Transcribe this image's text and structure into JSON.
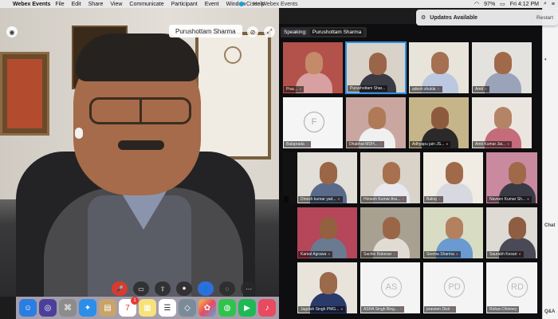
{
  "menubar": {
    "app_name": "Webex Events",
    "items": [
      "File",
      "Edit",
      "Share",
      "View",
      "Communicate",
      "Participant",
      "Event",
      "Window",
      "Help"
    ],
    "window_title": "Cisco Webex Events",
    "battery": "97%",
    "clock": "Fri 4:12 PM"
  },
  "notification": {
    "title": "Updates Available",
    "action": "Restart"
  },
  "main_video": {
    "speaker_name": "Purushottam Sharma"
  },
  "speaking": {
    "label": "Speaking:",
    "name": "Purushottam Sharma"
  },
  "tiles": [
    {
      "label": "Prac...",
      "initials": ""
    },
    {
      "label": "Purushottam Shar...",
      "initials": ""
    },
    {
      "label": "adesh shukla",
      "initials": ""
    },
    {
      "label": "Amit",
      "initials": ""
    },
    {
      "label": "Balaprada",
      "initials": "F"
    },
    {
      "label": "Dhabhat MDH...",
      "initials": ""
    },
    {
      "label": "Adhyapu jain JS...",
      "initials": ""
    },
    {
      "label": "Amit Kumar Jai...",
      "initials": ""
    },
    {
      "label": "",
      "initials": ""
    },
    {
      "label": "Dinesh kumar yad...",
      "initials": ""
    },
    {
      "label": "Himesh Kumar Ara...",
      "initials": ""
    },
    {
      "label": "Balraj",
      "initials": ""
    },
    {
      "label": "Naveen Kumar Sh...",
      "initials": ""
    },
    {
      "label": "Kamal Agrawa",
      "initials": ""
    },
    {
      "label": "Sachin Rakesar",
      "initials": ""
    },
    {
      "label": "Seema Sharma",
      "initials": ""
    },
    {
      "label": "Saurabh Kesari",
      "initials": ""
    },
    {
      "label": "Jagdish Singh PMG...",
      "initials": ""
    },
    {
      "label": "ASHA Singh Bing...",
      "initials": "AS"
    },
    {
      "label": "praveen Dixit",
      "initials": "PD"
    },
    {
      "label": "Rohan Dhinney",
      "initials": "RD"
    }
  ],
  "side_panel": {
    "chat_label": "Chat",
    "qa_label": "Q&A"
  },
  "controls": [
    "mute",
    "video",
    "share",
    "record",
    "participants",
    "chat",
    "more"
  ],
  "colors": {
    "mute_red": "#d93a2f",
    "active_blue": "#2e8fe8",
    "accent_blue": "#2d6fe0"
  },
  "dock": {
    "calendar_badge": "1",
    "calendar_date": "7"
  }
}
